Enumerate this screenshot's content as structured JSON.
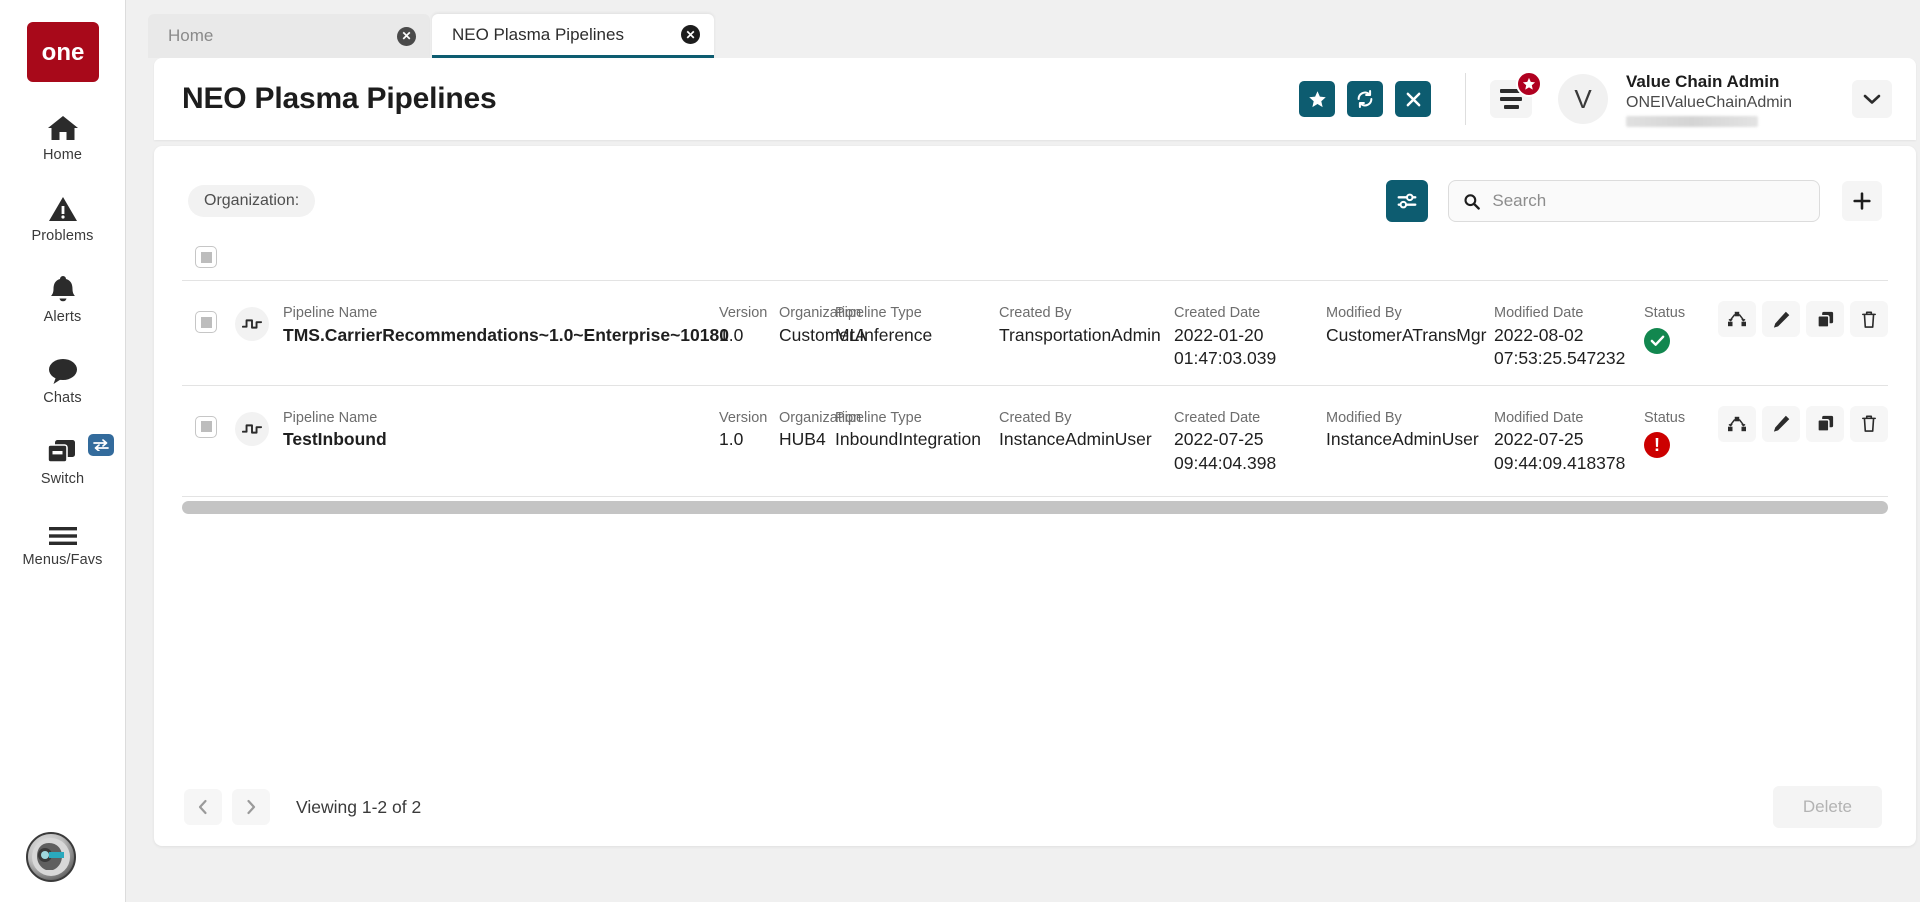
{
  "brand": {
    "logo_text": "one",
    "logo_color": "#a8091a",
    "accent_teal": "#0d5c70"
  },
  "sidebar": {
    "items": [
      {
        "label": "Home",
        "icon": "home-icon"
      },
      {
        "label": "Problems",
        "icon": "warning-triangle-icon"
      },
      {
        "label": "Alerts",
        "icon": "bell-icon"
      },
      {
        "label": "Chats",
        "icon": "chat-bubble-icon"
      },
      {
        "label": "Switch",
        "icon": "windows-switch-icon",
        "badge_icon": "swap-arrows-icon"
      },
      {
        "label": "Menus/Favs",
        "icon": "hamburger-icon"
      }
    ],
    "bot_avatar": "robot-head-avatar"
  },
  "tabs": [
    {
      "label": "Home",
      "active": false
    },
    {
      "label": "NEO Plasma Pipelines",
      "active": true
    }
  ],
  "header": {
    "title": "NEO Plasma Pipelines",
    "actions": [
      {
        "name": "favorite-button",
        "icon": "star-icon"
      },
      {
        "name": "refresh-button",
        "icon": "refresh-icon"
      },
      {
        "name": "close-button",
        "icon": "close-x-icon"
      }
    ],
    "menu_badge_icon": "star-badge-icon",
    "user": {
      "avatar_initial": "V",
      "name": "Value Chain Admin",
      "username": "ONEIValueChainAdmin",
      "redacted": true
    }
  },
  "toolbar": {
    "organization_chip": "Organization:",
    "filter_icon": "sliders-filter-icon",
    "search": {
      "placeholder": "Search",
      "value": "",
      "icon": "search-icon"
    },
    "add_icon": "plus-icon"
  },
  "table": {
    "select_all_state": "indeterminate",
    "columns": [
      "Pipeline Name",
      "Version",
      "Organization",
      "Pipeline Type",
      "Created By",
      "Created Date",
      "Modified By",
      "Modified Date",
      "Status"
    ],
    "row_actions": [
      {
        "name": "view-flow-button",
        "icon": "sitemap-icon"
      },
      {
        "name": "edit-button",
        "icon": "pencil-icon"
      },
      {
        "name": "duplicate-button",
        "icon": "copy-icon"
      },
      {
        "name": "delete-row-button",
        "icon": "trash-icon"
      }
    ],
    "rows": [
      {
        "icon": "pulse-wave-icon",
        "pipeline_name_label": "Pipeline Name",
        "pipeline_name": "TMS.CarrierRecommendations~1.0~Enterprise~10180",
        "version_label": "Version",
        "version": "1.0",
        "organization_label": "Organization",
        "organization": "CustomerA",
        "pipeline_type_label": "Pipeline Type",
        "pipeline_type": "MLInference",
        "created_by_label": "Created By",
        "created_by": "TransportationAdmin",
        "created_date_label": "Created Date",
        "created_date_1": "2022-01-20",
        "created_date_2": "01:47:03.039",
        "modified_by_label": "Modified By",
        "modified_by": "CustomerATransMgr",
        "modified_date_label": "Modified Date",
        "modified_date_1": "2022-08-02",
        "modified_date_2": "07:53:25.547232",
        "status_label": "Status",
        "status": "success",
        "status_color": "#12874f"
      },
      {
        "icon": "pulse-wave-icon",
        "pipeline_name_label": "Pipeline Name",
        "pipeline_name": "TestInbound",
        "version_label": "Version",
        "version": "1.0",
        "organization_label": "Organization",
        "organization": "HUB4",
        "pipeline_type_label": "Pipeline Type",
        "pipeline_type": "InboundIntegration",
        "created_by_label": "Created By",
        "created_by": "InstanceAdminUser",
        "created_date_label": "Created Date",
        "created_date_1": "2022-07-25",
        "created_date_2": "09:44:04.398",
        "modified_by_label": "Modified By",
        "modified_by": "InstanceAdminUser",
        "modified_date_label": "Modified Date",
        "modified_date_1": "2022-07-25",
        "modified_date_2": "09:44:09.418378",
        "status_label": "Status",
        "status": "error",
        "status_color": "#cc0000"
      }
    ]
  },
  "footer": {
    "prev_icon": "chevron-left-icon",
    "next_icon": "chevron-right-icon",
    "viewing": "Viewing 1-2 of 2",
    "delete_label": "Delete"
  }
}
